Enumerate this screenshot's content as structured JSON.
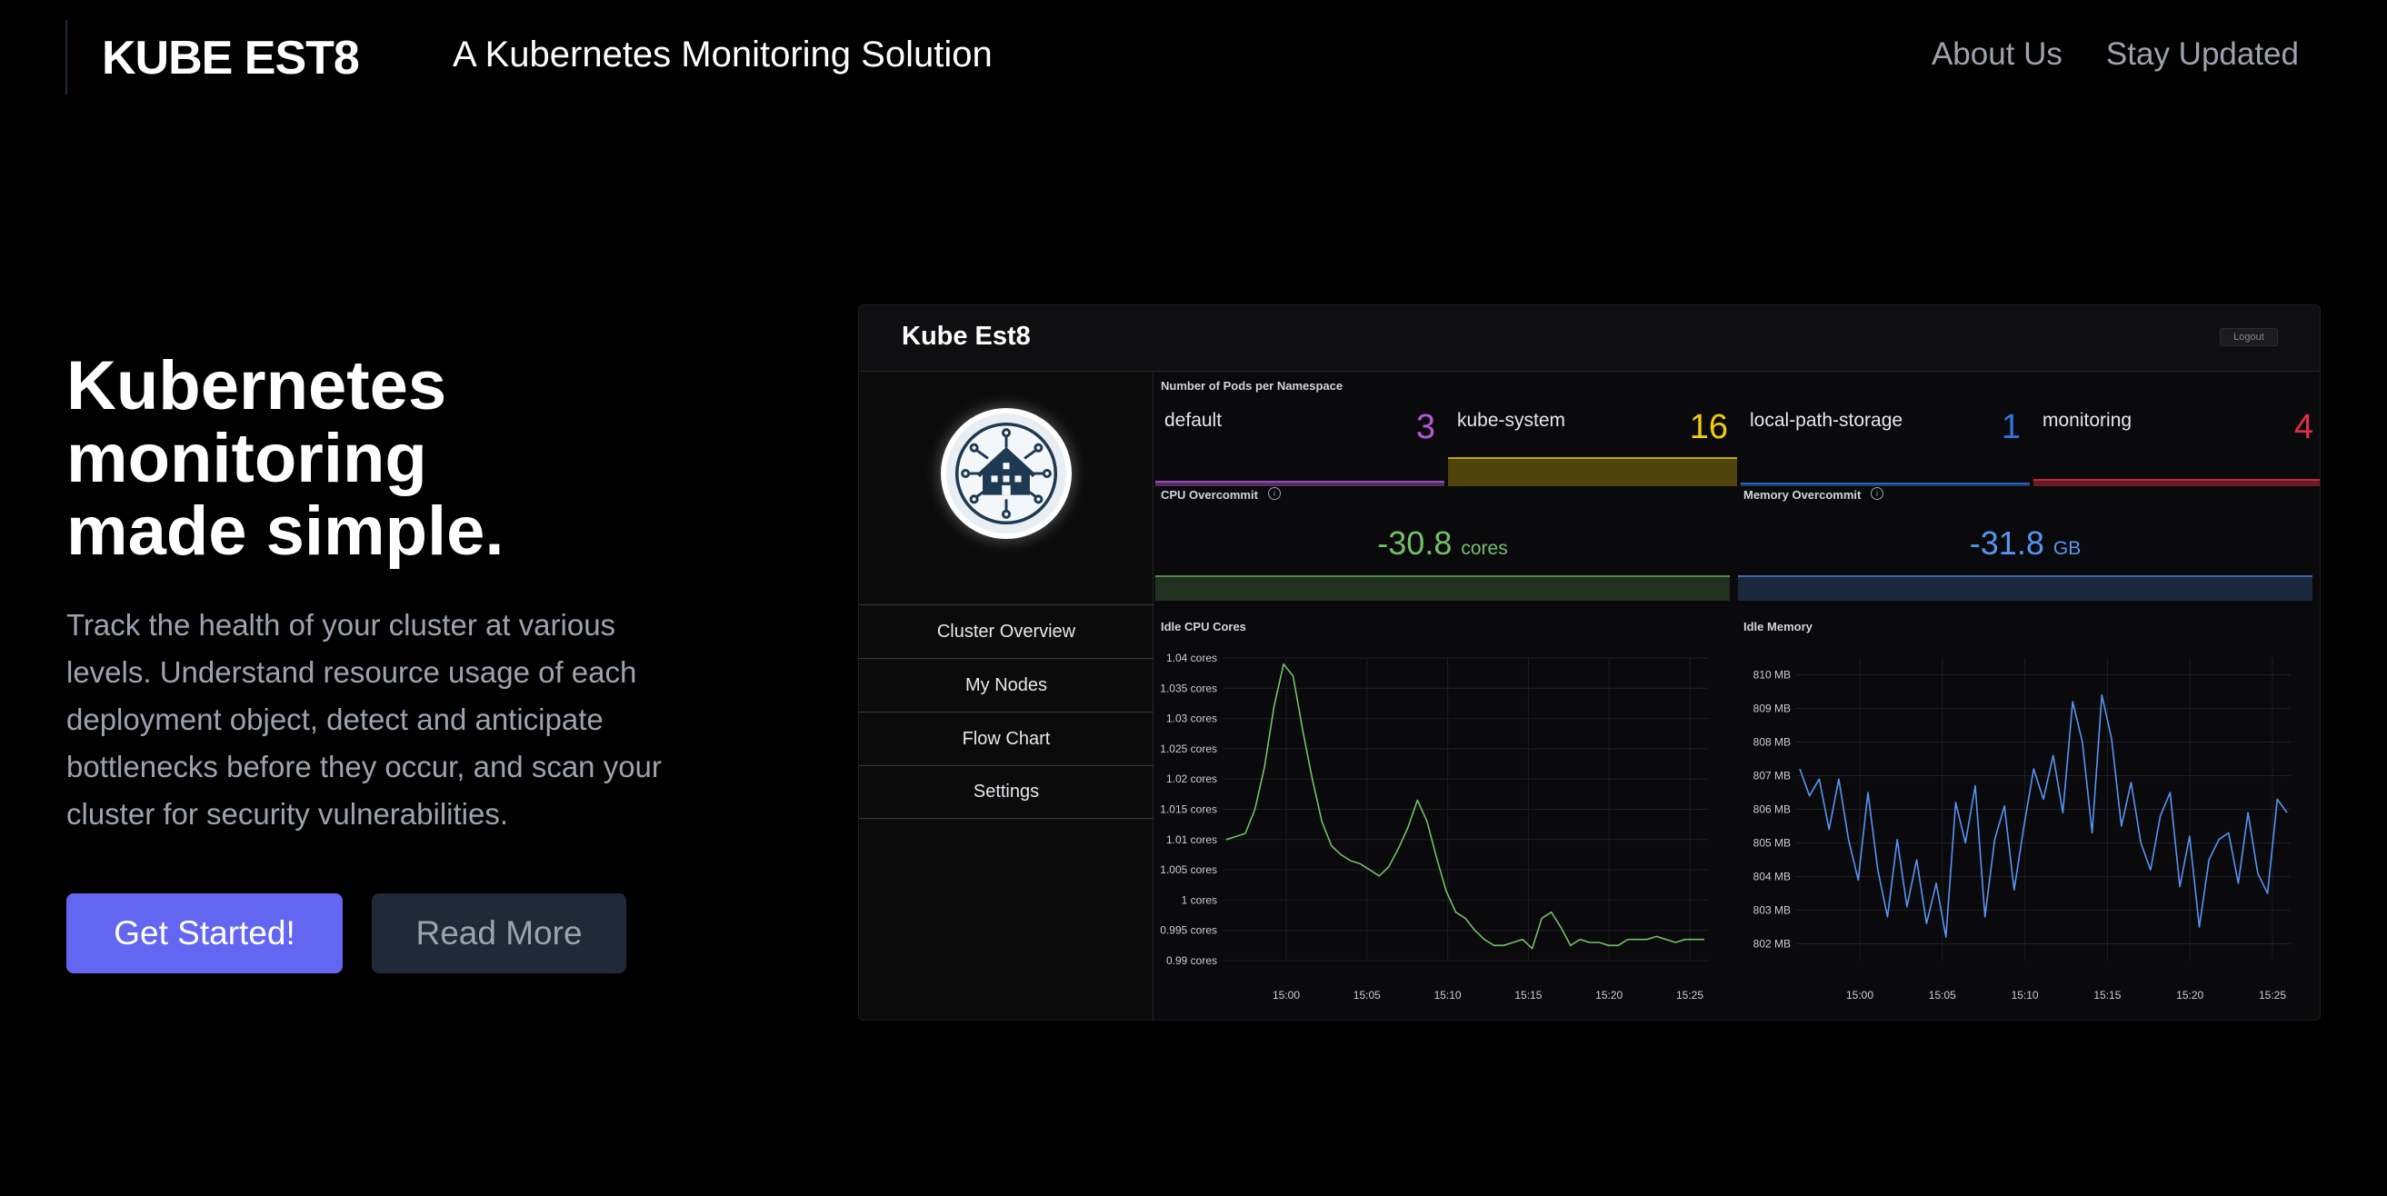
{
  "nav": {
    "logo": "KUBE EST8",
    "tagline": "A Kubernetes Monitoring Solution",
    "links": [
      "About Us",
      "Stay Updated"
    ]
  },
  "hero": {
    "title": "Kubernetes monitoring made simple.",
    "copy": "Track the health of your cluster at various levels. Understand resource usage of each deployment object, detect and anticipate bottlenecks before they occur, and scan your cluster for security vulnerabilities.",
    "primary_button": "Get Started!",
    "secondary_button": "Read More"
  },
  "dashboard": {
    "title": "Kube Est8",
    "logout": "Logout",
    "menu": [
      "Cluster Overview",
      "My Nodes",
      "Flow Chart",
      "Settings"
    ],
    "pods_label": "Number of Pods per Namespace",
    "namespaces": [
      {
        "name": "default",
        "count": "3",
        "color": "#b35ad6"
      },
      {
        "name": "kube-system",
        "count": "16",
        "color": "#f2cc0c"
      },
      {
        "name": "local-path-storage",
        "count": "1",
        "color": "#3274d9"
      },
      {
        "name": "monitoring",
        "count": "4",
        "color": "#e02f44"
      }
    ],
    "cpu_overcommit": {
      "label": "CPU Overcommit",
      "value": "-30.8",
      "unit": "cores",
      "color": "#73bf69"
    },
    "memory_overcommit": {
      "label": "Memory Overcommit",
      "value": "-31.8",
      "unit": "GB",
      "color": "#5794f2"
    },
    "info_icon": "i"
  },
  "chart_data": [
    {
      "type": "line",
      "title": "Idle CPU Cores",
      "x_ticks": [
        "15:00",
        "15:05",
        "15:10",
        "15:15",
        "15:20",
        "15:25"
      ],
      "y_ticks": [
        "0.99 cores",
        "0.995 cores",
        "1 cores",
        "1.005 cores",
        "1.01 cores",
        "1.015 cores",
        "1.02 cores",
        "1.025 cores",
        "1.03 cores",
        "1.035 cores",
        "1.04 cores"
      ],
      "ylim": [
        0.99,
        1.04
      ],
      "color": "#73bf69",
      "series": [
        {
          "values": [
            1.01,
            1.0105,
            1.011,
            1.015,
            1.022,
            1.032,
            1.039,
            1.037,
            1.028,
            1.02,
            1.013,
            1.009,
            1.0075,
            1.0065,
            1.006,
            1.005,
            1.004,
            1.0055,
            1.0085,
            1.012,
            1.0165,
            1.013,
            1.007,
            1.0015,
            0.998,
            0.997,
            0.995,
            0.9935,
            0.9925,
            0.9925,
            0.993,
            0.9935,
            0.992,
            0.997,
            0.998,
            0.9955,
            0.9925,
            0.9935,
            0.993,
            0.993,
            0.9925,
            0.9925,
            0.9935,
            0.9935,
            0.9935,
            0.994,
            0.9935,
            0.993,
            0.9935,
            0.9935,
            0.9935
          ]
        }
      ]
    },
    {
      "type": "line",
      "title": "Idle Memory",
      "x_ticks": [
        "15:00",
        "15:05",
        "15:10",
        "15:15",
        "15:20",
        "15:25"
      ],
      "y_ticks": [
        "802 MB",
        "803 MB",
        "804 MB",
        "805 MB",
        "806 MB",
        "807 MB",
        "808 MB",
        "809 MB",
        "810 MB"
      ],
      "ylim": [
        801.5,
        810.5
      ],
      "color": "#5794f2",
      "series": [
        {
          "values": [
            807.2,
            806.4,
            806.9,
            805.4,
            806.9,
            805.1,
            803.9,
            806.5,
            804.2,
            802.8,
            805.1,
            803.1,
            804.5,
            802.6,
            803.8,
            802.2,
            806.2,
            805.0,
            806.7,
            802.8,
            805.1,
            806.1,
            803.6,
            805.5,
            807.2,
            806.3,
            807.6,
            805.9,
            809.2,
            808.0,
            805.3,
            809.4,
            808.1,
            805.5,
            806.8,
            805.0,
            804.2,
            805.8,
            806.5,
            803.7,
            805.2,
            802.5,
            804.5,
            805.1,
            805.3,
            803.8,
            805.9,
            804.1,
            803.5,
            806.3,
            805.9
          ]
        }
      ]
    }
  ]
}
